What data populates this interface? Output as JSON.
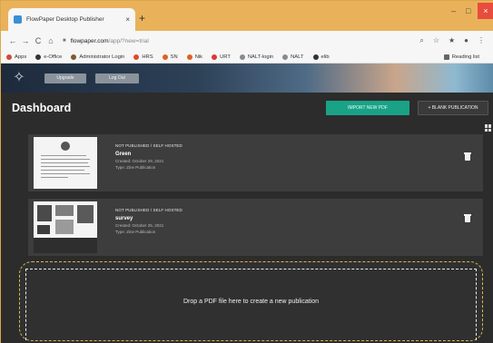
{
  "browser": {
    "tab_title": "FlowPaper Desktop Publisher",
    "tab_close": "×",
    "new_tab": "+",
    "window_min": "–",
    "window_max": "□",
    "window_close": "×",
    "nav_back": "←",
    "nav_forward": "→",
    "nav_reload": "C",
    "nav_home": "⌂",
    "url_domain": "flowpaper.com",
    "url_path": "/app/?new=trial",
    "toolbar_icons": [
      "⌕",
      "☆",
      "★",
      "●",
      "⋮"
    ],
    "bookmarks": [
      {
        "label": "Apps",
        "color": "#d04a3a"
      },
      {
        "label": "e-Office",
        "color": "#333333"
      },
      {
        "label": "Administrator Login",
        "color": "#7b5a2e"
      },
      {
        "label": "HRS",
        "color": "#e04a2a"
      },
      {
        "label": "SN",
        "color": "#e06020"
      },
      {
        "label": "Nik",
        "color": "#e06020"
      },
      {
        "label": "URT",
        "color": "#d83a3a"
      },
      {
        "label": "NALT-login",
        "color": "#8a8a8a"
      },
      {
        "label": "NALT",
        "color": "#8a8a8a"
      },
      {
        "label": "elib",
        "color": "#333333"
      }
    ],
    "reading_list": "Reading list"
  },
  "app": {
    "header_btn_1": "Upgrade",
    "header_btn_2": "Log Out",
    "page_title": "Dashboard",
    "import_button": "IMPORT NEW PDF",
    "blank_button": "+ BLANK PUBLICATION",
    "publications": [
      {
        "status": "NOT PUBLISHED / SELF HOSTED",
        "name": "Green",
        "created": "Created: October 29, 2021",
        "type": "Type: Zine Publication"
      },
      {
        "status": "NOT PUBLISHED / SELF HOSTED",
        "name": "survey",
        "created": "Created: October 25, 2021",
        "type": "Type: Zine Publication"
      }
    ],
    "dropzone_text": "Drop a PDF file here to create a new publication"
  }
}
